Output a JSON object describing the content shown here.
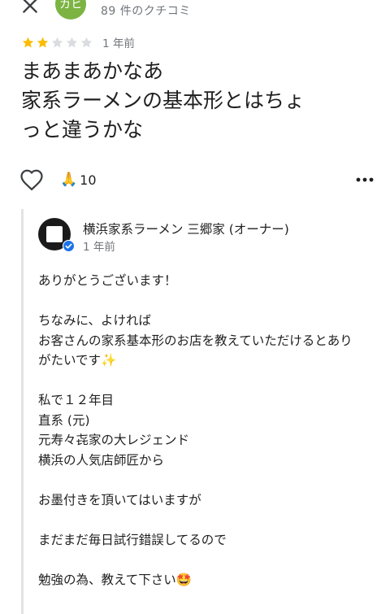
{
  "header": {
    "avatar_initials": "カヒ",
    "review_count": "89 件のクチコミ"
  },
  "rating": {
    "stars": 2,
    "max": 5,
    "filled_color": "#fbbc04",
    "empty_color": "#dadce0",
    "time_ago": "1 年前"
  },
  "review": {
    "lines": [
      "まあまあかなあ",
      "家系ラーメンの基本形とはちょ",
      "っと違うかな"
    ]
  },
  "actions": {
    "reaction_emoji": "🙏",
    "reaction_count": "10"
  },
  "owner_reply": {
    "name": "横浜家系ラーメン 三郷家 (オーナー)",
    "time_ago": "1 年前",
    "lines": [
      "ありがとうございます！",
      "",
      "ちなみに、よければ",
      "お客さんの家系基本形のお店を教えていただけるとあり",
      "がたいです✨",
      "",
      "私で１２年目",
      "直系 (元)",
      "元寿々㐂家の大レジェンド",
      "横浜の人気店師匠から",
      "",
      "お墨付きを頂いてはいますが",
      "",
      "まだまだ毎日試行錯誤してるので",
      "",
      "勉強の為、教えて下さい🤩"
    ]
  }
}
